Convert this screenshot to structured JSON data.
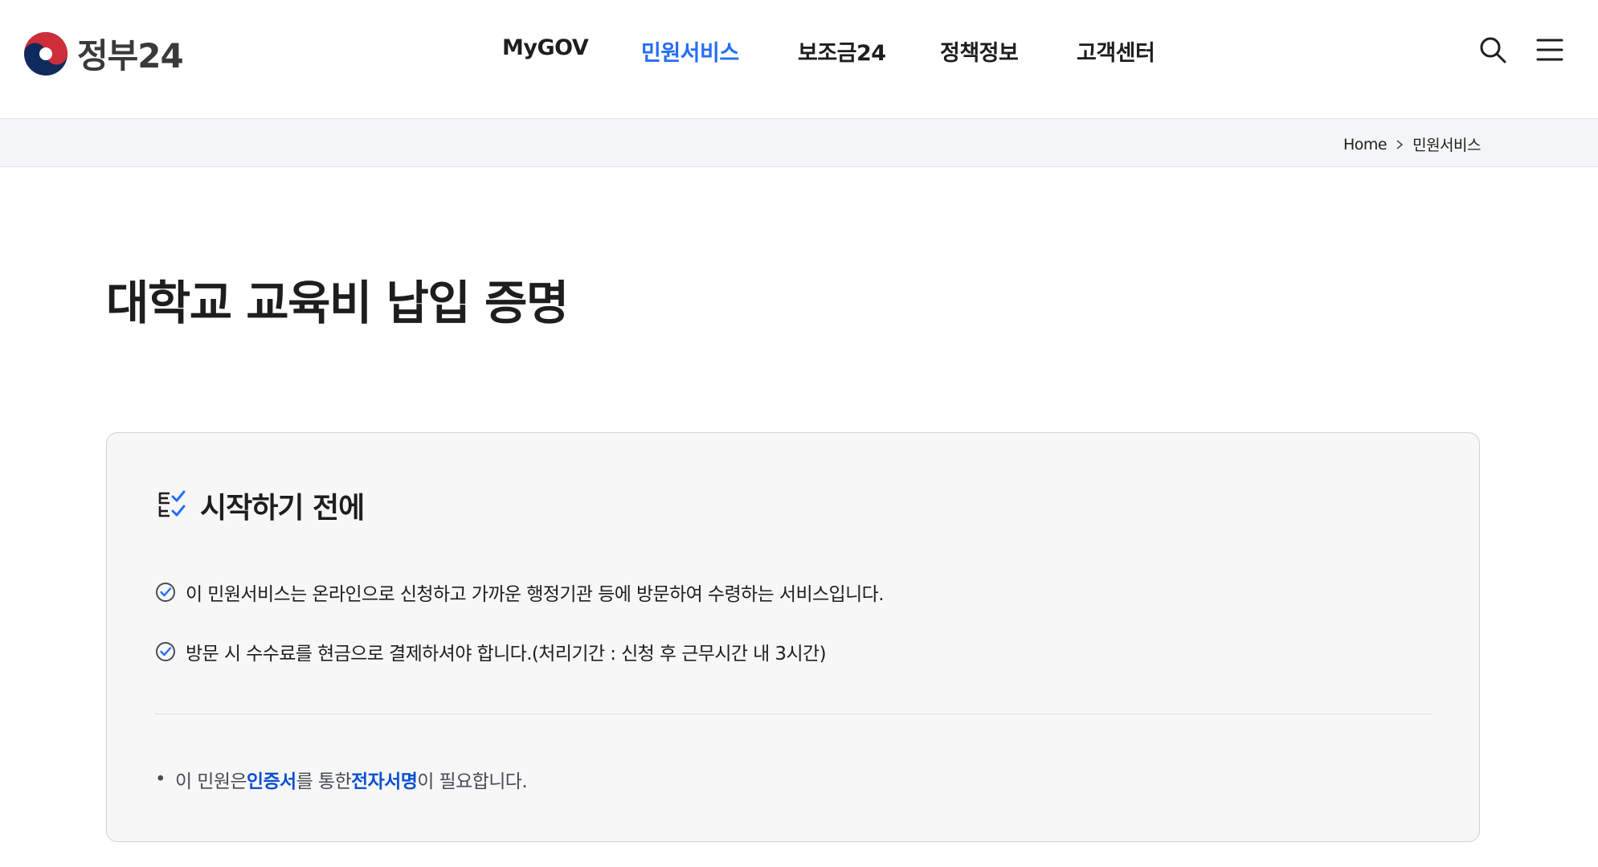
{
  "header": {
    "logo_text": "정부24",
    "nav": [
      {
        "label": "MyGOV",
        "active": false
      },
      {
        "label": "민원서비스",
        "active": true
      },
      {
        "label": "보조금24",
        "active": false
      },
      {
        "label": "정책정보",
        "active": false
      },
      {
        "label": "고객센터",
        "active": false
      }
    ],
    "icons": [
      "search-icon",
      "menu-icon"
    ]
  },
  "breadcrumb": {
    "home": "Home",
    "current": "민원서비스",
    "separator_icon": "chevron-right-icon"
  },
  "page": {
    "title": "대학교 교육비 납입 증명"
  },
  "info_box": {
    "heading": "시작하기 전에",
    "heading_icon": "checklist-icon",
    "checks": [
      "이 민원서비스는 온라인으로 신청하고 가까운 행정기관 등에 방문하여 수령하는 서비스입니다.",
      "방문 시 수수료를 현금으로 결제하셔야 합니다.(처리기간 : 신청 후 근무시간 내 3시간)"
    ],
    "note": {
      "bullet": "•",
      "part1": "이 민원은 ",
      "em1": "인증서",
      "part2": "를 통한 ",
      "em2": "전자서명",
      "part3": "이 필요합니다."
    }
  },
  "colors": {
    "accent": "#256ef4",
    "emphasis": "#0b50d0",
    "text": "#1e1e1e",
    "crumb_bg": "#f4f5f6",
    "box_bg": "#f7f7f8",
    "box_border": "#cdd1d5",
    "logo_red": "#cd2e3a",
    "logo_navy": "#0f2a5c"
  }
}
